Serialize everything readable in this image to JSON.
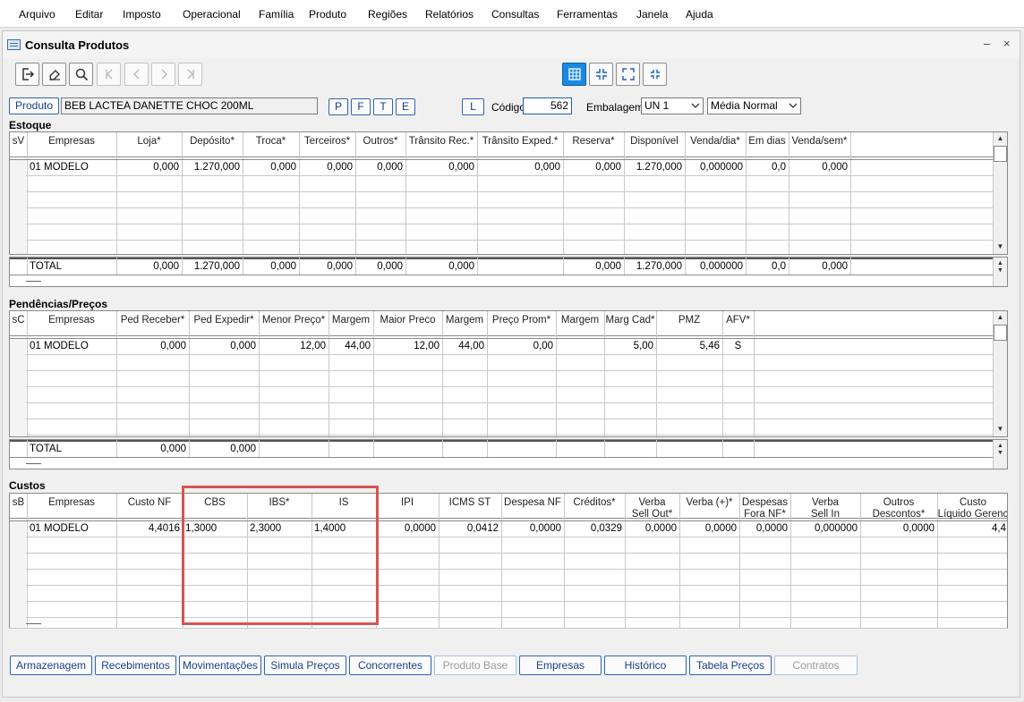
{
  "menu": [
    "Arquivo",
    "Editar",
    "Imposto",
    "Operacional",
    "Família",
    "Produto",
    "Regiões",
    "Relatórios",
    "Consultas",
    "Ferramentas",
    "Janela",
    "Ajuda"
  ],
  "window": {
    "title": "Consulta Produtos",
    "minimize_label": "–",
    "close_label": "×"
  },
  "toolbar": {
    "icons": [
      "exit-icon",
      "eraser-icon",
      "search-icon",
      "first-page-icon",
      "prev-page-icon",
      "next-page-icon",
      "last-page-icon"
    ],
    "view_icons": [
      "grid-view-icon",
      "collapse-icon",
      "expand-icon",
      "shrink-icon"
    ]
  },
  "product": {
    "produto_button": "Produto",
    "description": "BEB LACTEA DANETTE CHOC 200ML",
    "filter_buttons": [
      "P",
      "F",
      "T",
      "E"
    ],
    "l_button": "L",
    "codigo_label": "Código",
    "codigo_value": "562",
    "embalagem_label": "Embalagem",
    "embalagem_value": "UN  1",
    "media_value": "Média Normal"
  },
  "estoque": {
    "title": "Estoque",
    "columns": [
      "sV",
      "Empresas",
      "Loja*",
      "Depósito*",
      "Troca*",
      "Terceiros*",
      "Outros*",
      "Trânsito Rec.*",
      "Trânsito Exped.*",
      "Reserva*",
      "Disponível",
      "Venda/dia*",
      "Em dias",
      "Venda/sem*"
    ],
    "rows": [
      [
        "",
        "01 MODELO",
        "0,000",
        "1.270,000",
        "0,000",
        "0,000",
        "0,000",
        "0,000",
        "0,000",
        "0,000",
        "1.270,000",
        "0,000000",
        "0,0",
        "0,000"
      ]
    ],
    "total": [
      "",
      "TOTAL",
      "0,000",
      "1.270,000",
      "0,000",
      "0,000",
      "0,000",
      "0,000",
      "",
      "0,000",
      "1.270,000",
      "0,000000",
      "0,0",
      "0,000"
    ]
  },
  "pendencias": {
    "title": "Pendências/Preços",
    "columns": [
      "sC",
      "Empresas",
      "Ped Receber*",
      "Ped Expedir*",
      "Menor Preço*",
      "Margem",
      "Maior Preco",
      "Margem",
      "Preço Prom*",
      "Margem",
      "Marg Cad*",
      "PMZ",
      "AFV*"
    ],
    "rows": [
      [
        "",
        "01 MODELO",
        "0,000",
        "0,000",
        "12,00",
        "44,00",
        "12,00",
        "44,00",
        "0,00",
        "",
        "5,00",
        "5,46",
        "S"
      ]
    ],
    "total": [
      "",
      "TOTAL",
      "0,000",
      "0,000",
      "",
      "",
      "",
      "",
      "",
      "",
      "",
      "",
      ""
    ]
  },
  "custos": {
    "title": "Custos",
    "columns": [
      "sB",
      "Empresas",
      "Custo NF",
      "CBS",
      "IBS*",
      "IS",
      "IPI",
      "ICMS ST",
      "Despesa NF",
      "Créditos*",
      "Verba\nSell Out*",
      "Verba (+)*",
      "Despesas\nFora NF*",
      "Verba\nSell In",
      "Outros\nDescontos*",
      "Custo\nLíquido Gerenc"
    ],
    "rows": [
      [
        "",
        "01 MODELO",
        "4,4016",
        "1,3000",
        "2,3000",
        "1,4000",
        "0,0000",
        "0,0412",
        "0,0000",
        "0,0329",
        "0,0000",
        "0,0000",
        "0,0000",
        "0,000000",
        "0,0000",
        "4,4"
      ]
    ]
  },
  "bottom_buttons": [
    {
      "label": "Armazenagem",
      "enabled": true
    },
    {
      "label": "Recebimentos",
      "enabled": true
    },
    {
      "label": "Movimentações",
      "enabled": true
    },
    {
      "label": "Simula Preços",
      "enabled": true
    },
    {
      "label": "Concorrentes",
      "enabled": true
    },
    {
      "label": "Produto Base",
      "enabled": false
    },
    {
      "label": "Empresas",
      "enabled": true
    },
    {
      "label": "Histórico",
      "enabled": true
    },
    {
      "label": "Tabela Preços",
      "enabled": true
    },
    {
      "label": "Contratos",
      "enabled": false
    }
  ],
  "colors": {
    "accent": "#1a8ae0",
    "button_text": "#1a3f8a",
    "highlight": "#d9534f"
  }
}
